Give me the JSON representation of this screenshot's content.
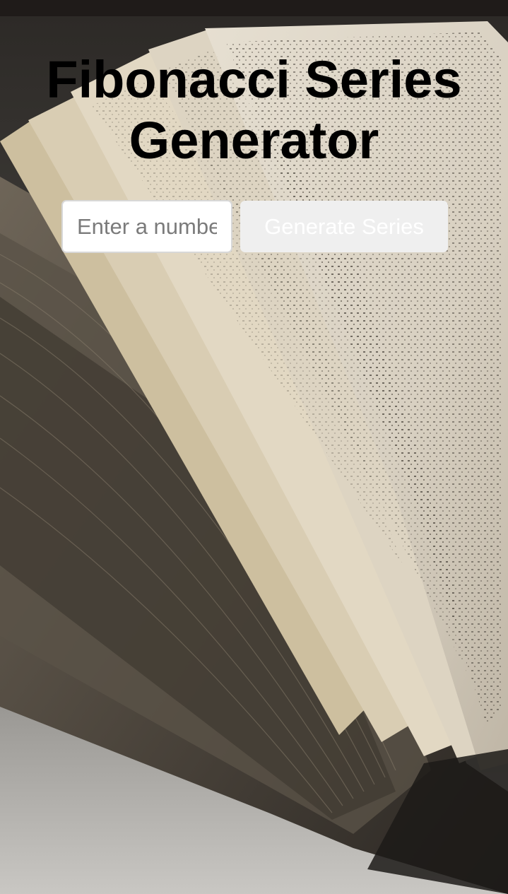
{
  "header": {
    "title": "Fibonacci Series Generator"
  },
  "form": {
    "number_input": {
      "value": "",
      "placeholder": "Enter a number"
    },
    "generate_label": "Generate Series"
  },
  "background": {
    "subject": "open-book-photo",
    "colors": {
      "page_paper": "#d9d2c4",
      "shadow": "#1e1b18",
      "table": "#8d8b87"
    }
  },
  "colors": {
    "title": "#000000",
    "button_bg": "#efefef",
    "button_text": "#ffffff",
    "status_bar": "#1f1b19"
  }
}
